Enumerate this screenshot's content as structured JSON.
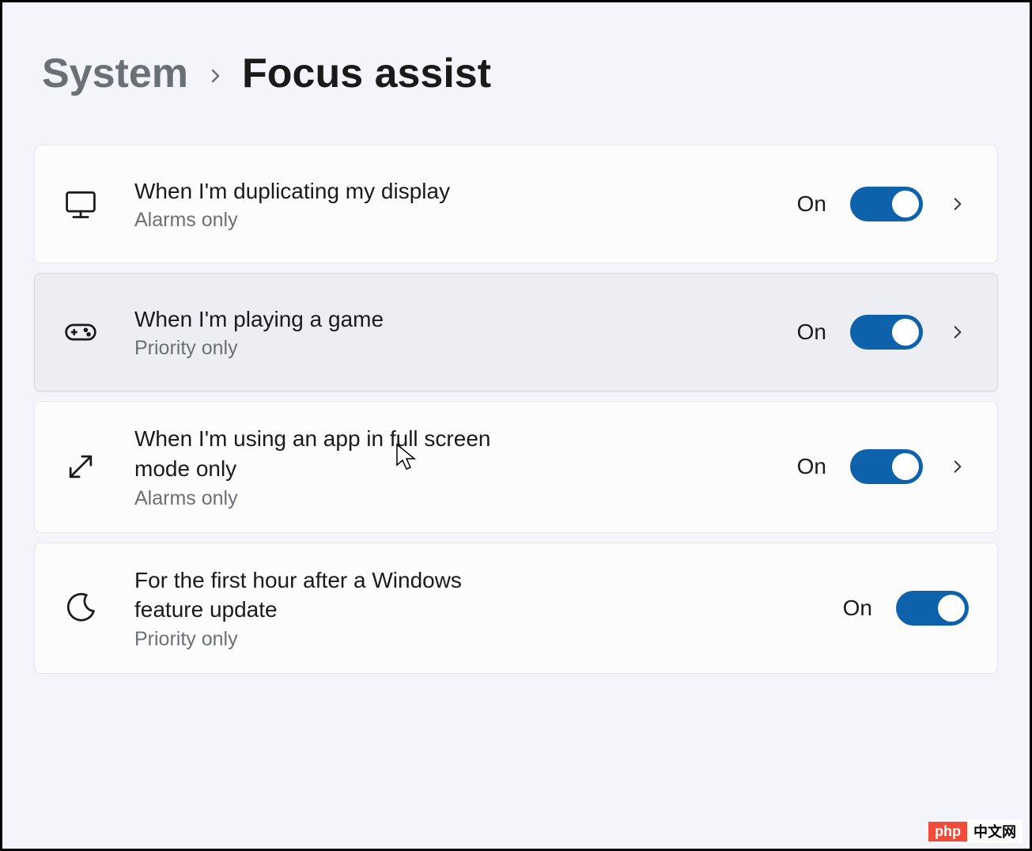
{
  "breadcrumb": {
    "parent": "System",
    "current": "Focus assist"
  },
  "rules": [
    {
      "icon": "monitor-icon",
      "title": "When I'm duplicating my display",
      "subtitle": "Alarms only",
      "state": "On",
      "on": true,
      "expandable": true,
      "hovered": false
    },
    {
      "icon": "gamepad-icon",
      "title": "When I'm playing a game",
      "subtitle": "Priority only",
      "state": "On",
      "on": true,
      "expandable": true,
      "hovered": true
    },
    {
      "icon": "fullscreen-icon",
      "title": "When I'm using an app in full screen mode only",
      "subtitle": "Alarms only",
      "state": "On",
      "on": true,
      "expandable": true,
      "hovered": false
    },
    {
      "icon": "moon-icon",
      "title": "For the first hour after a Windows feature update",
      "subtitle": "Priority only",
      "state": "On",
      "on": true,
      "expandable": false,
      "hovered": false
    }
  ],
  "colors": {
    "accent": "#0e62ab",
    "page_bg": "#f3f5fa",
    "card_bg": "#fcfcfd",
    "card_hover_bg": "#eceef3",
    "text_primary": "#1a1a1a",
    "text_secondary": "#6b7076"
  },
  "watermark": {
    "left": "php",
    "right": "中文网"
  }
}
